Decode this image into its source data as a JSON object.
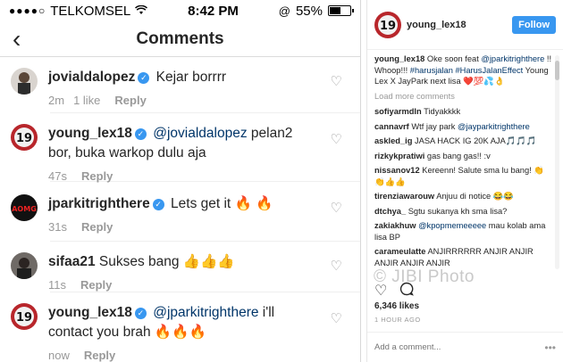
{
  "status_bar": {
    "carrier": "TELKOMSEL",
    "time": "8:42 PM",
    "battery": "55%",
    "battery_level": 0.55
  },
  "nav": {
    "title": "Comments"
  },
  "comments": [
    {
      "user": "jovialdalopez",
      "text": "Kejar borrrr",
      "time": "2m",
      "likes": "1 like",
      "reply": "Reply"
    },
    {
      "user": "young_lex18",
      "mention": "@jovialdalopez",
      "text": " pelan2 bor, buka warkop dulu aja",
      "time": "47s",
      "reply": "Reply"
    },
    {
      "user": "jparkitrighthere",
      "text": "Lets get it 🔥 🔥",
      "time": "31s",
      "reply": "Reply"
    },
    {
      "user": "sifaa21",
      "text": "Sukses bang 👍👍👍",
      "time": "11s",
      "reply": "Reply"
    },
    {
      "user": "young_lex18",
      "mention": "@jparkitrighthere",
      "text": " i'll contact you brah 🔥🔥🔥",
      "time": "now",
      "reply": "Reply"
    }
  ],
  "post": {
    "username": "young_lex18",
    "follow_label": "Follow",
    "caption_user": "young_lex18",
    "caption_a": " Oke soon feat",
    "caption_mention": "@jparkitrighthere",
    "caption_b": " !! Whoop!!! ",
    "caption_tag1": "#harusjalan",
    "caption_tag2": "#HarusJalanEffect",
    "caption_c": " Young Lex X JayPark next lisa ❤️💯💦👌",
    "load_more": "Load more comments",
    "feed": [
      {
        "user": "sofiyarmdln",
        "text": " Tidyakkkk"
      },
      {
        "user": "cannavrf",
        "text": " Wtf jay park ",
        "mention": "@jayparkitrighthere"
      },
      {
        "user": "askled_ig",
        "text": " JASA HACK IG 20K AJA🎵🎵🎵"
      },
      {
        "user": "rizkykpratiwi",
        "text": " gas bang gas!! :v"
      },
      {
        "user": "nissanov12",
        "text": " Kereenn! Salute sma lu bang! 👏👏👍👍"
      },
      {
        "user": "tirenziawarouw",
        "text": " Anjuu di notice 😂😂"
      },
      {
        "user": "dtchya_",
        "text": " Sgtu sukanya kh sma lisa?"
      },
      {
        "user": "zakiakhuw",
        "text": " ",
        "mention": "@kpopmemeeeee",
        "text2": " mau kolab ama lisa BP"
      },
      {
        "user": "carameulatte",
        "text": " ANJIRRRRRR ANJIR ANJIR ANJIR ANJIR ANJIR"
      }
    ],
    "likes": "6,346 likes",
    "time": "1 HOUR AGO",
    "add_comment_placeholder": "Add a comment...",
    "watermark": "© JIBI Photo"
  },
  "colors": {
    "accent": "#3897f0",
    "mention": "#003569",
    "muted": "#999999"
  }
}
